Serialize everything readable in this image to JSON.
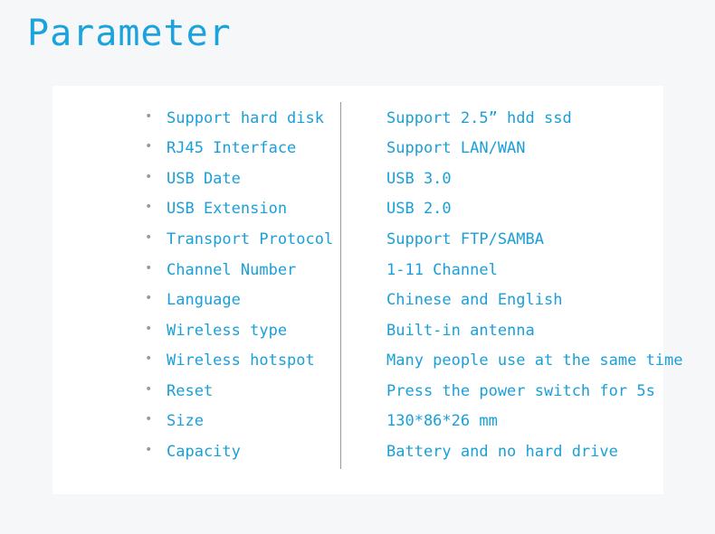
{
  "title": "Parameter",
  "colors": {
    "accent": "#1a9fd8",
    "bullet": "#9a9a9a"
  },
  "rows": [
    {
      "label": "Support hard disk",
      "value": "Support 2.5” hdd ssd"
    },
    {
      "label": "RJ45 Interface",
      "value": "Support LAN/WAN"
    },
    {
      "label": "USB Date",
      "value": "USB 3.0"
    },
    {
      "label": "USB Extension",
      "value": "USB 2.0"
    },
    {
      "label": "Transport Protocol",
      "value": "Support FTP/SAMBA"
    },
    {
      "label": "Channel Number",
      "value": "1-11 Channel"
    },
    {
      "label": "Language",
      "value": "Chinese and English"
    },
    {
      "label": "Wireless type",
      "value": "Built-in antenna"
    },
    {
      "label": "Wireless hotspot",
      "value": "Many people use at the same time"
    },
    {
      "label": "Reset",
      "value": "Press the power switch for 5s"
    },
    {
      "label": "Size",
      "value": "130*86*26 mm"
    },
    {
      "label": "Capacity",
      "value": "Battery and no hard drive"
    }
  ]
}
